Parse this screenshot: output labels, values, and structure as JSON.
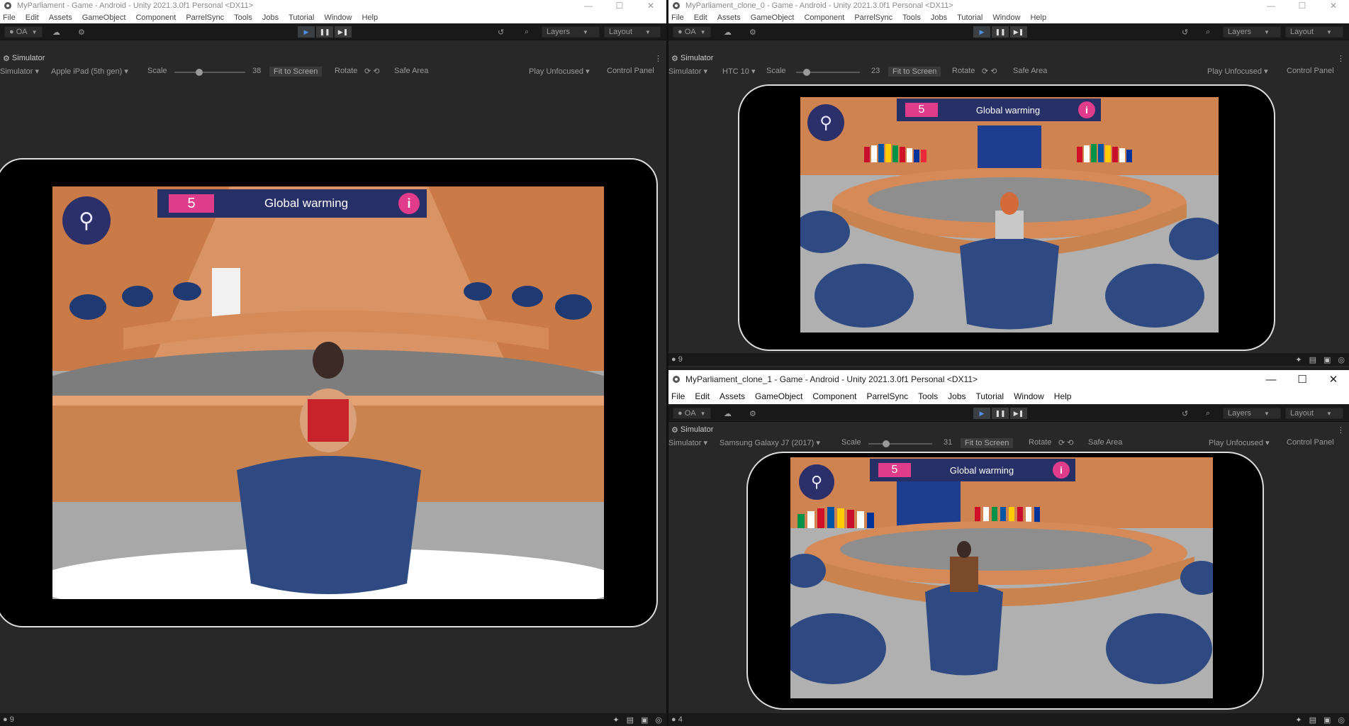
{
  "windows": [
    {
      "title": "MyParliament - Game - Android - Unity 2021.3.0f1 Personal <DX11>",
      "menu": [
        "File",
        "Edit",
        "Assets",
        "GameObject",
        "Component",
        "ParrelSync",
        "Tools",
        "Jobs",
        "Tutorial",
        "Window",
        "Help"
      ],
      "toolbar": {
        "account": "OA",
        "layers": "Layers",
        "layout": "Layout"
      },
      "panel_tab": "Simulator",
      "simbar": {
        "mode": "Simulator",
        "device": "Apple iPad (5th gen)",
        "scale_label": "Scale",
        "scale_value": "38",
        "fit": "Fit to Screen",
        "rotate": "Rotate",
        "safe_area": "Safe Area",
        "play_mode": "Play Unfocused",
        "control_panel": "Control Panel"
      },
      "hud": {
        "number": "5",
        "title": "Global warming",
        "info": "i"
      },
      "status": {
        "count": "9"
      }
    },
    {
      "title": "MyParliament_clone_0 - Game - Android - Unity 2021.3.0f1 Personal <DX11>",
      "menu": [
        "File",
        "Edit",
        "Assets",
        "GameObject",
        "Component",
        "ParrelSync",
        "Tools",
        "Jobs",
        "Tutorial",
        "Window",
        "Help"
      ],
      "toolbar": {
        "account": "OA",
        "layers": "Layers",
        "layout": "Layout"
      },
      "panel_tab": "Simulator",
      "simbar": {
        "mode": "Simulator",
        "device": "HTC 10",
        "scale_label": "Scale",
        "scale_value": "23",
        "fit": "Fit to Screen",
        "rotate": "Rotate",
        "safe_area": "Safe Area",
        "play_mode": "Play Unfocused",
        "control_panel": "Control Panel"
      },
      "hud": {
        "number": "5",
        "title": "Global warming",
        "info": "i"
      },
      "status": {
        "count": "9"
      }
    },
    {
      "title": "MyParliament_clone_1 - Game - Android - Unity 2021.3.0f1 Personal <DX11>",
      "menu": [
        "File",
        "Edit",
        "Assets",
        "GameObject",
        "Component",
        "ParrelSync",
        "Tools",
        "Jobs",
        "Tutorial",
        "Window",
        "Help"
      ],
      "toolbar": {
        "account": "OA",
        "layers": "Layers",
        "layout": "Layout"
      },
      "panel_tab": "Simulator",
      "simbar": {
        "mode": "Simulator",
        "device": "Samsung Galaxy J7 (2017)",
        "scale_label": "Scale",
        "scale_value": "31",
        "fit": "Fit to Screen",
        "rotate": "Rotate",
        "safe_area": "Safe Area",
        "play_mode": "Play Unfocused",
        "control_panel": "Control Panel"
      },
      "hud": {
        "number": "5",
        "title": "Global warming",
        "info": "i"
      },
      "status": {
        "count": "4"
      }
    }
  ],
  "colors": {
    "hud_bar": "#273066",
    "hud_accent": "#e03c8b",
    "wood": "#d98b5a",
    "chair": "#2f4a82",
    "play_active": "#4d8fe0"
  },
  "icons": {
    "window_controls": [
      "minimize-icon",
      "maximize-icon",
      "close-icon"
    ],
    "glyphs": {
      "minimize": "—",
      "maximize": "☐",
      "close": "✕"
    }
  }
}
